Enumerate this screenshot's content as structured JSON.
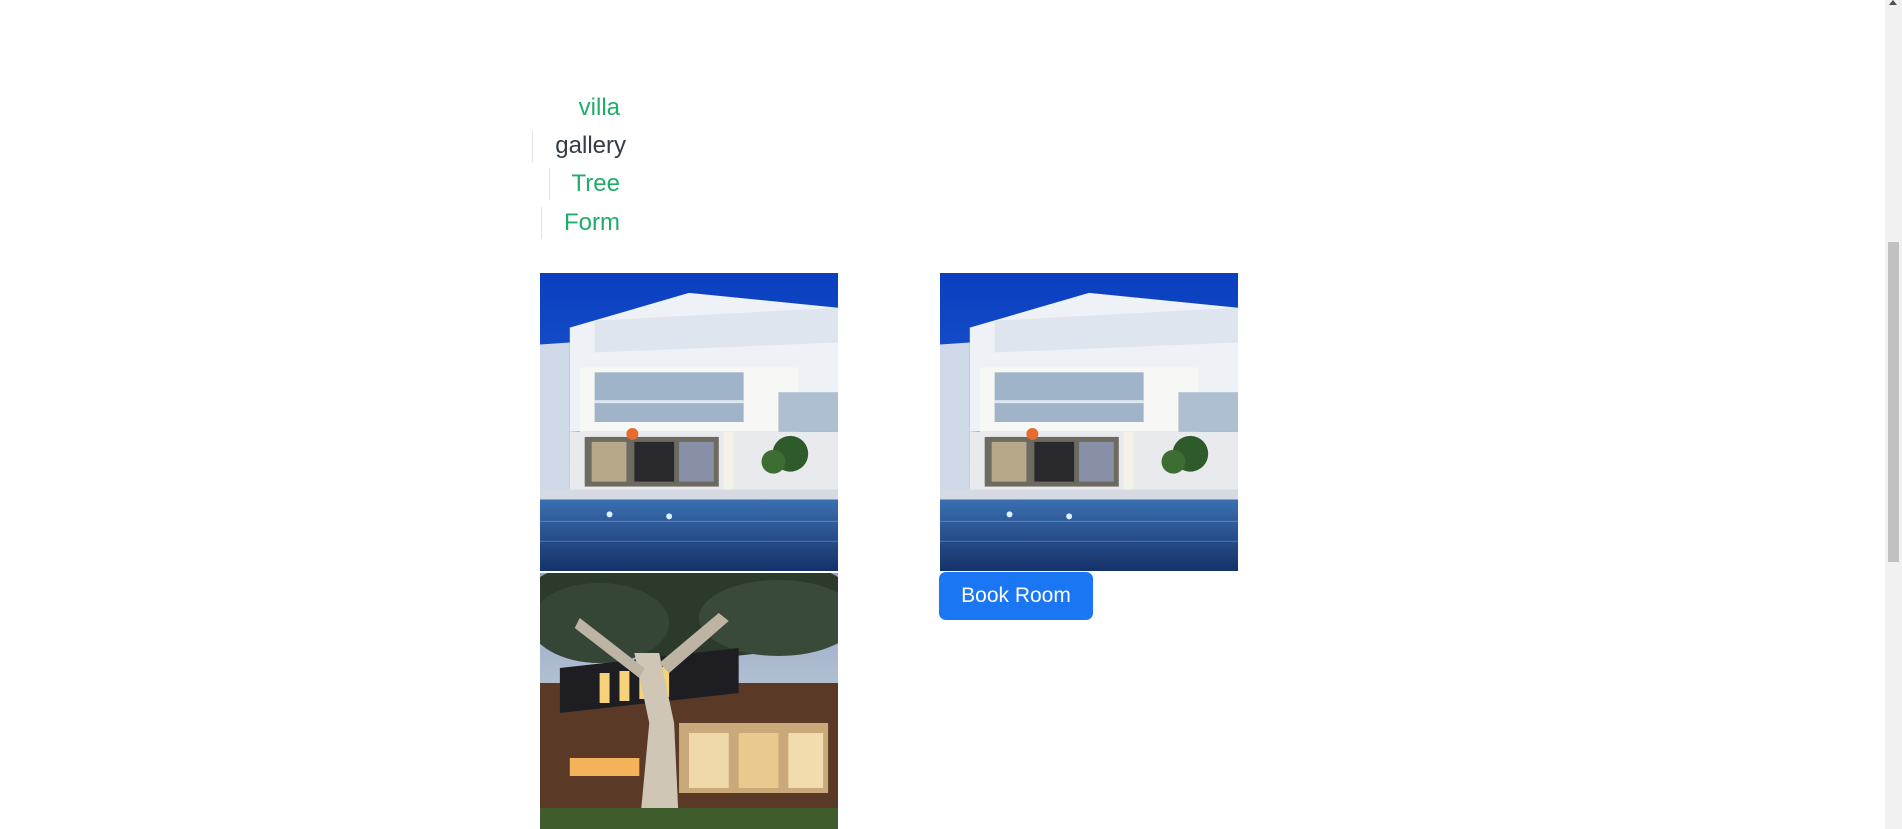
{
  "nav": {
    "items": [
      {
        "label": "villa",
        "state": "link"
      },
      {
        "label": "gallery",
        "state": "active"
      },
      {
        "label": "Tree",
        "state": "link"
      },
      {
        "label": "Form",
        "state": "link"
      }
    ]
  },
  "gallery": {
    "images": [
      {
        "subject": "modern white villa with pool at dusk"
      },
      {
        "subject": "modern white villa with pool at dusk"
      },
      {
        "subject": "modern house under large tree at dusk"
      }
    ],
    "book_button_label": "Book Room"
  },
  "colors": {
    "link": "#1fae68",
    "active_link": "#333b44",
    "button": "#1a76f2",
    "button_text": "#ffffff",
    "scrollbar_track": "#f1f1f1",
    "scrollbar_thumb": "#c1c1c1"
  }
}
